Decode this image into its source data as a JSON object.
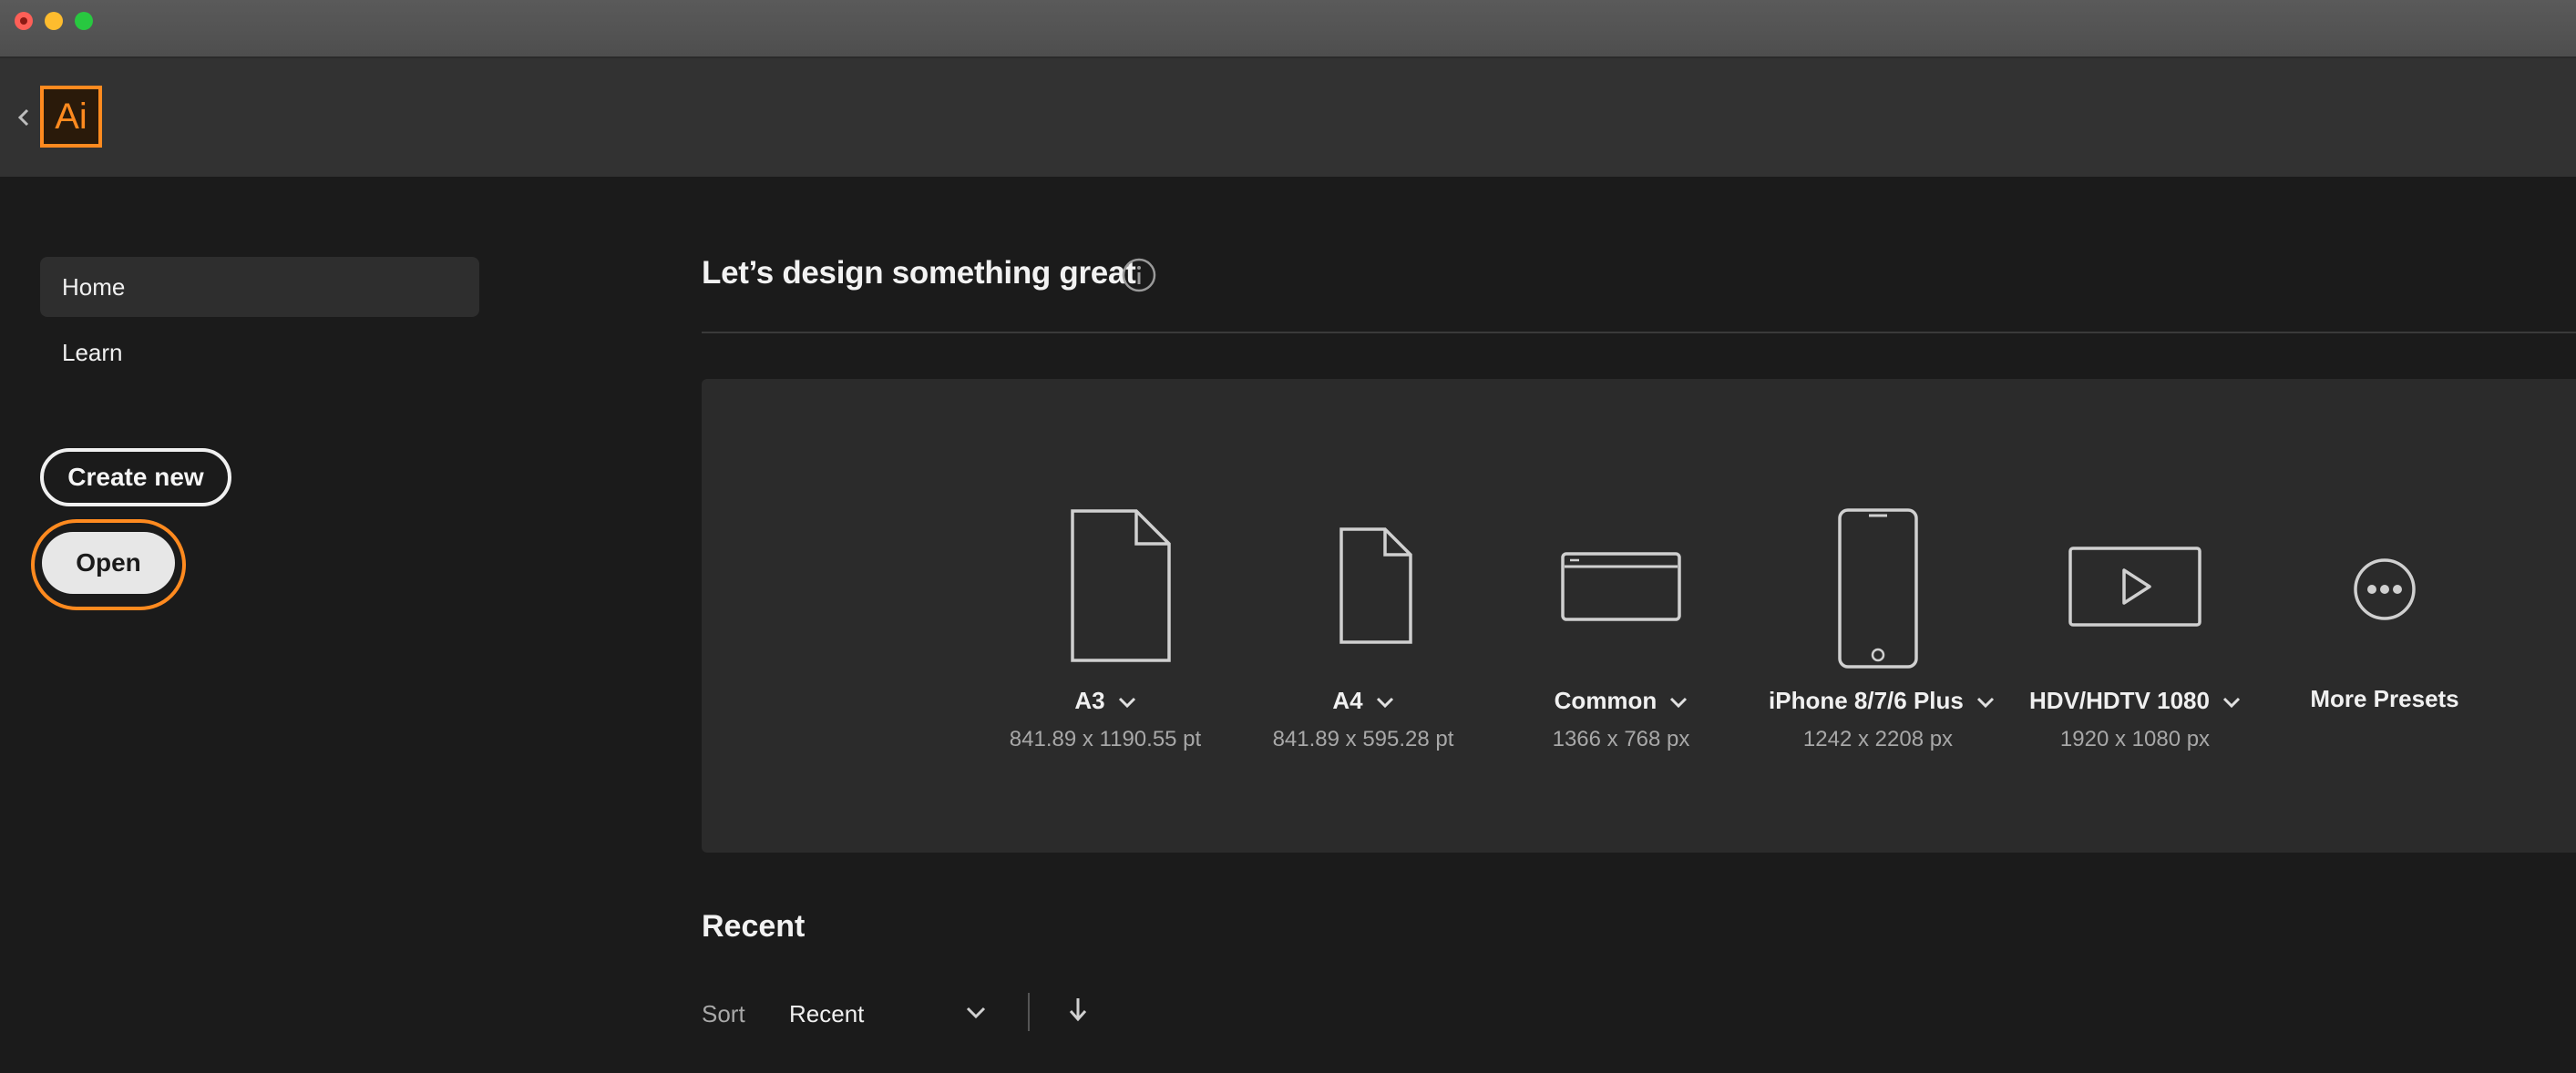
{
  "app": {
    "logo_text": "Ai",
    "accent_color": "#ff8a1f"
  },
  "sidebar": {
    "items": [
      {
        "label": "Home",
        "active": true
      },
      {
        "label": "Learn",
        "active": false
      }
    ],
    "create_new_label": "Create new",
    "open_label": "Open"
  },
  "main": {
    "headline": "Let’s design something great",
    "presets": [
      {
        "name": "A3",
        "size": "841.89 x 1190.55 pt",
        "icon": "document-large-icon",
        "has_dropdown": true
      },
      {
        "name": "A4",
        "size": "841.89 x 595.28 pt",
        "icon": "document-icon",
        "has_dropdown": true
      },
      {
        "name": "Common",
        "size": "1366 x 768 px",
        "icon": "browser-window-icon",
        "has_dropdown": true
      },
      {
        "name": "iPhone 8/7/6 Plus",
        "size": "1242 x 2208 px",
        "icon": "phone-icon",
        "has_dropdown": true
      },
      {
        "name": "HDV/HDTV 1080",
        "size": "1920 x 1080 px",
        "icon": "video-play-icon",
        "has_dropdown": true
      },
      {
        "name": "More Presets",
        "size": "",
        "icon": "more-icon",
        "has_dropdown": false
      }
    ],
    "recent": {
      "title": "Recent",
      "sort_label": "Sort",
      "sort_value": "Recent"
    }
  }
}
